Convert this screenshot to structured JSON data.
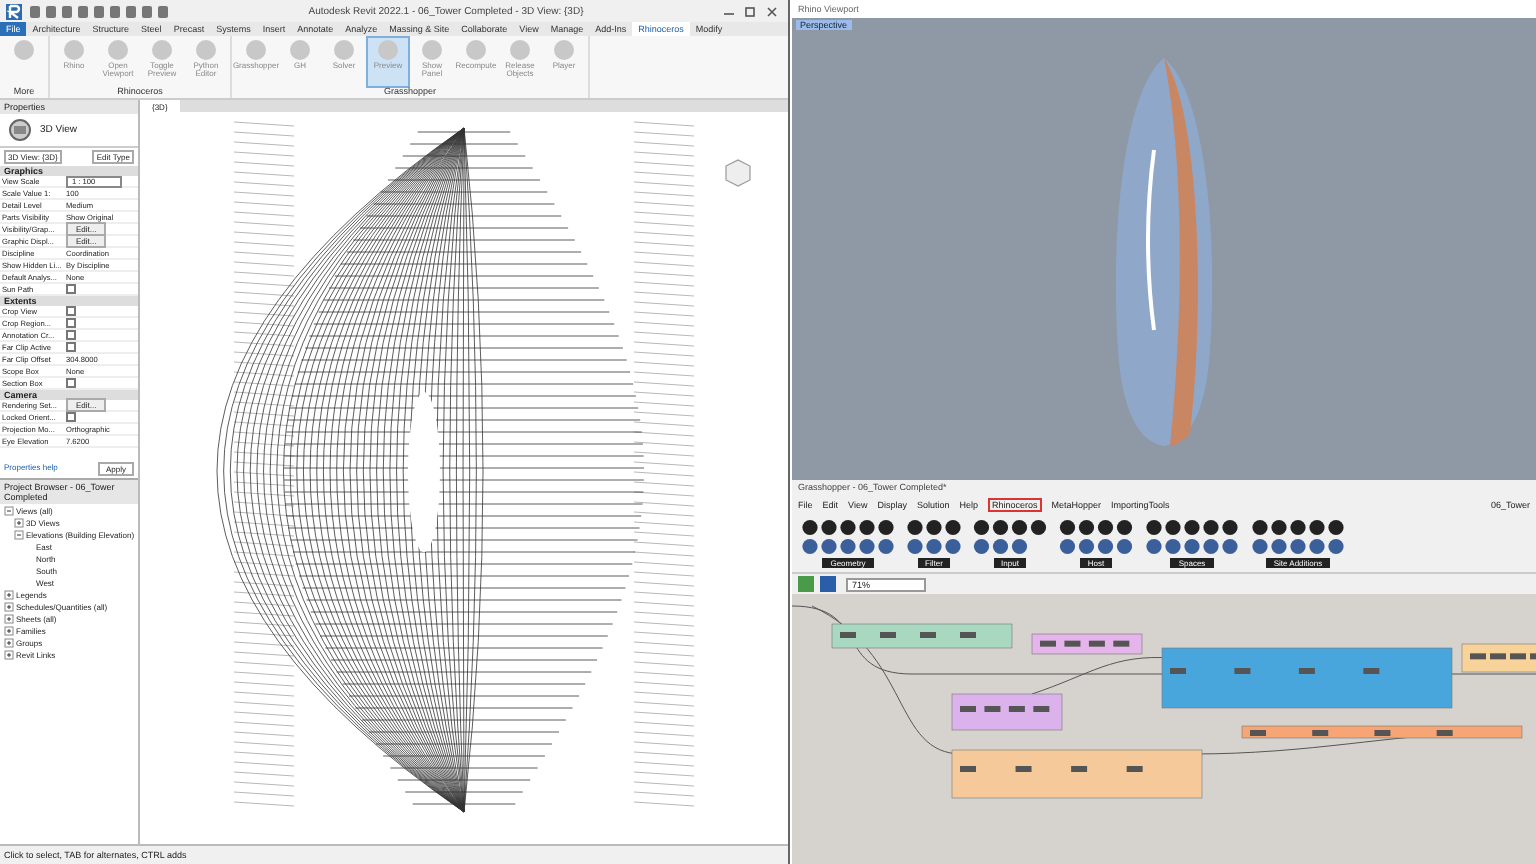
{
  "revit": {
    "title": "Autodesk Revit 2022.1 - 06_Tower Completed - 3D View: {3D}",
    "tabs": [
      {
        "label": "File",
        "selected": false,
        "kind": "file"
      },
      {
        "label": "Architecture",
        "selected": false
      },
      {
        "label": "Structure",
        "selected": false
      },
      {
        "label": "Steel",
        "selected": false
      },
      {
        "label": "Precast",
        "selected": false
      },
      {
        "label": "Systems",
        "selected": false
      },
      {
        "label": "Insert",
        "selected": false
      },
      {
        "label": "Annotate",
        "selected": false
      },
      {
        "label": "Analyze",
        "selected": false
      },
      {
        "label": "Massing & Site",
        "selected": false
      },
      {
        "label": "Collaborate",
        "selected": false
      },
      {
        "label": "View",
        "selected": false
      },
      {
        "label": "Manage",
        "selected": false
      },
      {
        "label": "Add-Ins",
        "selected": false
      },
      {
        "label": "Rhinoceros",
        "selected": true
      },
      {
        "label": "Modify",
        "selected": false
      }
    ],
    "ribbon_panels": [
      {
        "label": "More",
        "buttons": [
          {
            "selected": false
          }
        ]
      },
      {
        "label": "Rhinoceros",
        "buttons": [
          {
            "label": "Rhino",
            "selected": false
          },
          {
            "label": "Open Viewport",
            "selected": false
          },
          {
            "label": "Toggle Preview",
            "selected": false
          },
          {
            "label": "Python Editor",
            "selected": false
          }
        ]
      },
      {
        "label": "Grasshopper",
        "buttons": [
          {
            "label": "Grasshopper",
            "selected": false
          },
          {
            "label": "GH",
            "selected": false
          },
          {
            "label": "Solver",
            "selected": false
          },
          {
            "label": "Preview",
            "selected": true
          },
          {
            "label": "Show Panel",
            "selected": false
          },
          {
            "label": "Recompute",
            "selected": false
          },
          {
            "label": "Release Objects",
            "selected": false
          },
          {
            "label": "Player",
            "selected": false
          }
        ]
      }
    ],
    "view_tabs": [
      {
        "label": "{3D}",
        "selected": true
      }
    ],
    "properties": {
      "title": "Properties",
      "type": "3D View",
      "selector": "3D View: {3D}",
      "edit_type": "Edit Type",
      "groups": [
        {
          "label": "Graphics",
          "rows": [
            {
              "name": "View Scale",
              "value": "1 : 100",
              "kind": "field"
            },
            {
              "name": "Scale Value 1:",
              "value": "100",
              "kind": "text"
            },
            {
              "name": "Detail Level",
              "value": "Medium",
              "kind": "text"
            },
            {
              "name": "Parts Visibility",
              "value": "Show Original",
              "kind": "text"
            },
            {
              "name": "Visibility/Grap...",
              "value": "Edit...",
              "kind": "button"
            },
            {
              "name": "Graphic Displ...",
              "value": "Edit...",
              "kind": "button"
            },
            {
              "name": "Discipline",
              "value": "Coordination",
              "kind": "text"
            },
            {
              "name": "Show Hidden Li...",
              "value": "By Discipline",
              "kind": "text"
            },
            {
              "name": "Default Analys...",
              "value": "None",
              "kind": "text"
            },
            {
              "name": "Sun Path",
              "checked": false,
              "kind": "check"
            }
          ]
        },
        {
          "label": "Extents",
          "rows": [
            {
              "name": "Crop View",
              "checked": false,
              "kind": "check"
            },
            {
              "name": "Crop Region...",
              "checked": false,
              "kind": "check"
            },
            {
              "name": "Annotation Cr...",
              "checked": false,
              "kind": "check"
            },
            {
              "name": "Far Clip Active",
              "checked": false,
              "kind": "check"
            },
            {
              "name": "Far Clip Offset",
              "value": "304.8000",
              "kind": "text"
            },
            {
              "name": "Scope Box",
              "value": "None",
              "kind": "text"
            },
            {
              "name": "Section Box",
              "checked": false,
              "kind": "check"
            }
          ]
        },
        {
          "label": "Camera",
          "rows": [
            {
              "name": "Rendering Set...",
              "value": "Edit...",
              "kind": "button"
            },
            {
              "name": "Locked Orient...",
              "checked": false,
              "kind": "check"
            },
            {
              "name": "Projection Mo...",
              "value": "Orthographic",
              "kind": "text"
            },
            {
              "name": "Eye Elevation",
              "value": "7.6200",
              "kind": "text"
            }
          ]
        }
      ],
      "help": "Properties help",
      "apply": "Apply"
    },
    "browser": {
      "title": "Project Browser - 06_Tower Completed",
      "tree": [
        {
          "label": "Views (all)",
          "expanded": true,
          "children": [
            {
              "label": "3D Views",
              "expanded": false
            },
            {
              "label": "Elevations (Building Elevation)",
              "expanded": true,
              "children": [
                {
                  "label": "East"
                },
                {
                  "label": "North"
                },
                {
                  "label": "South"
                },
                {
                  "label": "West"
                }
              ]
            }
          ]
        },
        {
          "label": "Legends",
          "expanded": false
        },
        {
          "label": "Schedules/Quantities (all)",
          "expanded": false
        },
        {
          "label": "Sheets (all)",
          "expanded": false
        },
        {
          "label": "Families",
          "expanded": false
        },
        {
          "label": "Groups",
          "expanded": false
        },
        {
          "label": "Revit Links",
          "expanded": false
        }
      ]
    },
    "status_bar": "Click to select, TAB for alternates, CTRL adds"
  },
  "rhino": {
    "title": "Rhino Viewport",
    "viewport_label": "Perspective"
  },
  "grasshopper": {
    "title": "Grasshopper - 06_Tower Completed*",
    "menus": [
      {
        "label": "File",
        "selected": false
      },
      {
        "label": "Edit",
        "selected": false
      },
      {
        "label": "View",
        "selected": false
      },
      {
        "label": "Display",
        "selected": false
      },
      {
        "label": "Solution",
        "selected": false
      },
      {
        "label": "Help",
        "selected": false
      },
      {
        "label": "Rhinoceros",
        "selected": true
      },
      {
        "label": "MetaHopper",
        "selected": false
      },
      {
        "label": "ImportingTools",
        "selected": false
      }
    ],
    "document_name": "06_Tower",
    "toolbar_groups": [
      {
        "label": "Geometry"
      },
      {
        "label": "Filter"
      },
      {
        "label": "Input"
      },
      {
        "label": "Host"
      },
      {
        "label": "Spaces"
      },
      {
        "label": "Site Additions"
      }
    ],
    "zoom": "71%"
  }
}
